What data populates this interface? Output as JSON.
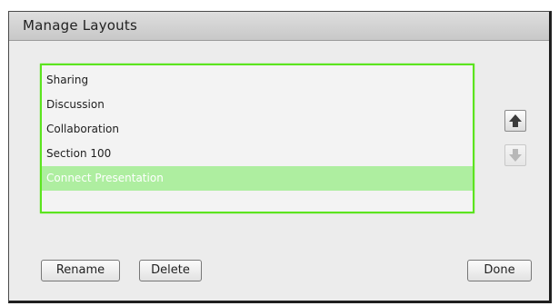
{
  "dialog": {
    "title": "Manage Layouts"
  },
  "layouts": {
    "items": [
      {
        "label": "Sharing",
        "selected": false
      },
      {
        "label": "Discussion",
        "selected": false
      },
      {
        "label": "Collaboration",
        "selected": false
      },
      {
        "label": "Section 100",
        "selected": false
      },
      {
        "label": "Connect Presentation",
        "selected": true
      }
    ]
  },
  "controls": {
    "move_up_icon": "arrow-up-icon",
    "move_down_icon": "arrow-down-icon",
    "move_down_enabled": false
  },
  "buttons": {
    "rename_label": "Rename",
    "delete_label": "Delete",
    "done_label": "Done"
  },
  "colors": {
    "selection": "#aeeea0",
    "focus_border": "#5ce41f"
  }
}
